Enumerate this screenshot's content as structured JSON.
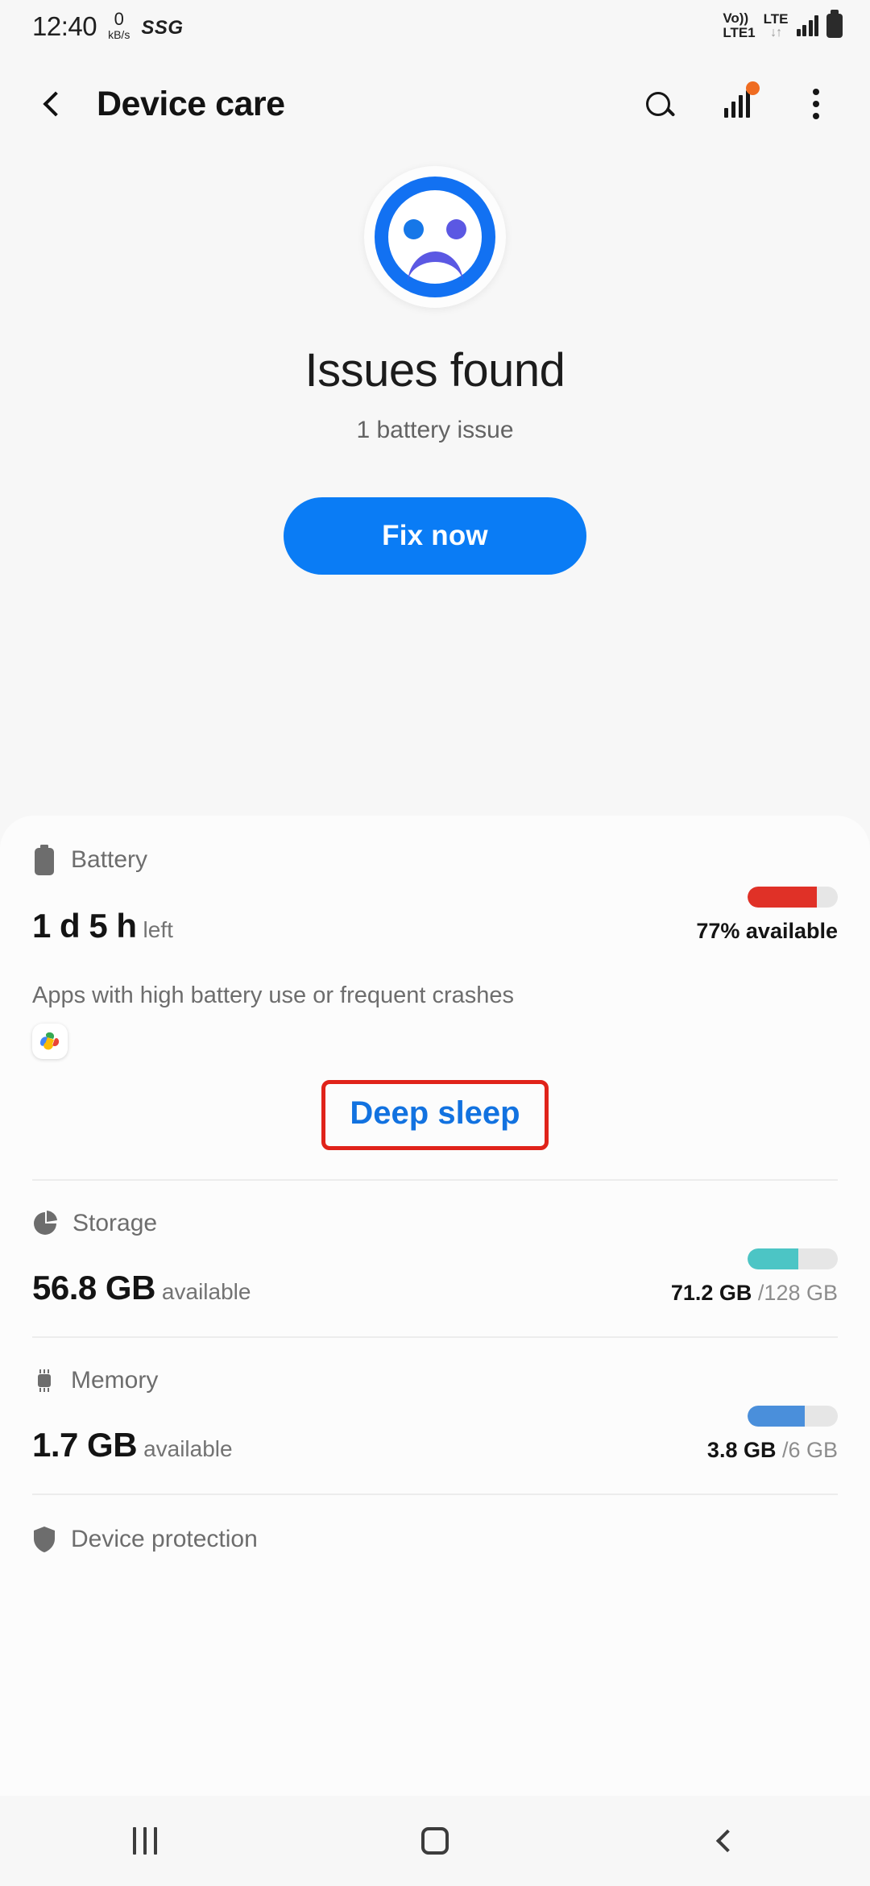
{
  "status_bar": {
    "time": "12:40",
    "network_speed_value": "0",
    "network_speed_unit": "kB/s",
    "carrier": "SSG",
    "volte_top": "Vo))",
    "volte_bottom": "LTE1",
    "lte_label": "LTE",
    "lte_arrows": "↓↑"
  },
  "app_bar": {
    "title": "Device care",
    "back_icon": "chevron-left-icon",
    "search_icon": "search-icon",
    "stats_icon": "bar-chart-icon",
    "badge_color": "#ef6c21",
    "overflow_icon": "more-vertical-icon"
  },
  "hero": {
    "face_icon": "sad-face-icon",
    "face_ring_color": "#1271f2",
    "eye_left_color": "#1677e8",
    "eye_right_color": "#5b58e3",
    "mouth_color": "#5b58e3",
    "title": "Issues found",
    "subtitle": "1 battery issue",
    "button_label": "Fix now",
    "button_color": "#0a7cf5"
  },
  "battery": {
    "icon": "battery-icon",
    "label": "Battery",
    "value": "1 d 5 h",
    "value_unit": "left",
    "percent": 77,
    "meter_text_strong": "77%",
    "meter_text_muted": " available",
    "meter_color": "#e03127",
    "apps_note": "Apps with high battery use or frequent crashes",
    "app_icons": [
      "google-multicolor-app-icon"
    ],
    "deep_sleep_label": "Deep sleep",
    "deep_sleep_text_color": "#1272e0",
    "deep_sleep_border_color": "#e0231a"
  },
  "storage": {
    "icon": "pie-chart-icon",
    "label": "Storage",
    "value": "56.8 GB",
    "value_unit": "available",
    "percent": 56,
    "used_text": "71.2 GB",
    "total_text": " /128 GB",
    "meter_color": "#4cc5c5"
  },
  "memory": {
    "icon": "memory-chip-icon",
    "label": "Memory",
    "value": "1.7 GB",
    "value_unit": "available",
    "percent": 63,
    "used_text": "3.8 GB",
    "total_text": " /6 GB",
    "meter_color": "#4a8fdb"
  },
  "device_protection": {
    "icon": "shield-icon",
    "label": "Device protection"
  },
  "nav_bar": {
    "recents_icon": "recents-icon",
    "home_icon": "home-icon",
    "back_icon": "back-icon"
  }
}
